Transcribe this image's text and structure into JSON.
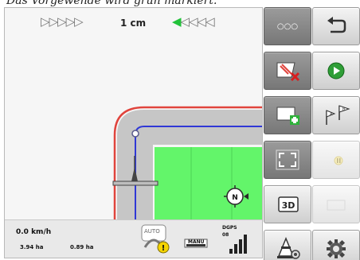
{
  "caption": "Das Vorgewende wird grün markiert.",
  "map": {
    "lightbar": {
      "left": "▷▷▷▷▷",
      "center": "1 cm",
      "right_active": "◀",
      "right": "◁◁◁◁"
    },
    "compass": "N"
  },
  "status": {
    "speed": "0.0 km/h",
    "area_left": "3.94 ha",
    "area_right": "0.89 ha",
    "auto_label": "AUTO",
    "manu_label": "MANU",
    "gnss_label": "DGPS",
    "gnss_value": "08"
  },
  "buttons": [
    {
      "name": "more-button",
      "icon": "ellipsis-icon",
      "label": "○○○"
    },
    {
      "name": "back-button",
      "icon": "back-arrow-icon"
    },
    {
      "name": "delete-headland-button",
      "icon": "field-delete-icon"
    },
    {
      "name": "play-button",
      "icon": "play-icon"
    },
    {
      "name": "add-field-button",
      "icon": "field-add-icon"
    },
    {
      "name": "ab-line-button",
      "icon": "ab-flags-icon",
      "label": "A B"
    },
    {
      "name": "fullscreen-button",
      "icon": "fullscreen-icon"
    },
    {
      "name": "disabled-button-1",
      "icon": "pause-icon"
    },
    {
      "name": "view-3d-button",
      "icon": "3d-icon",
      "label": "3D"
    },
    {
      "name": "disabled-button-2",
      "icon": "gray-icon"
    },
    {
      "name": "implement-settings-button",
      "icon": "cone-settings-icon"
    },
    {
      "name": "settings-button",
      "icon": "gear-icon"
    }
  ],
  "colors": {
    "headland_green": "#63f56a",
    "boundary_red": "#e0443d",
    "guidance_blue": "#2f38d6",
    "button_dark": "#838383",
    "accent_green": "#22c23a"
  }
}
